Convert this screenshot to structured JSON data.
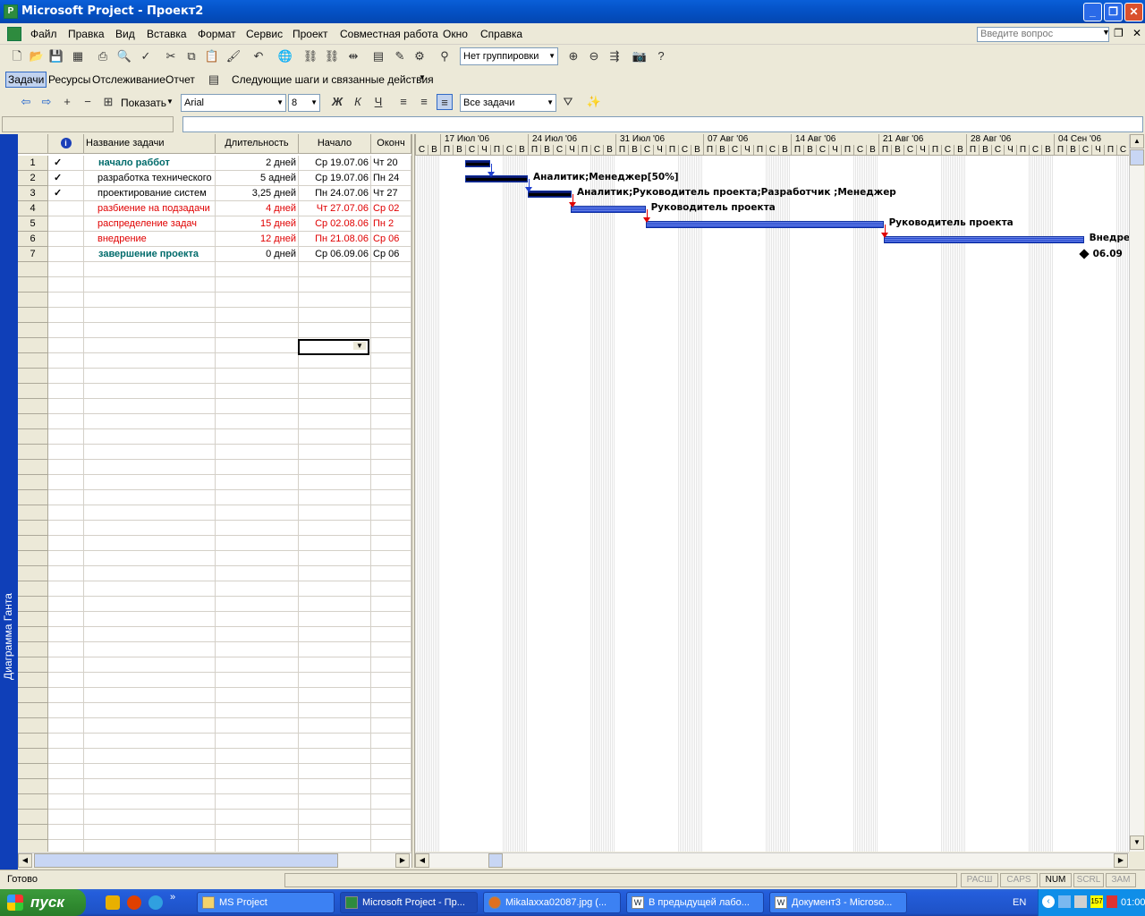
{
  "window": {
    "title": "Microsoft Project - Проект2"
  },
  "menu": [
    "Файл",
    "Правка",
    "Вид",
    "Вставка",
    "Формат",
    "Сервис",
    "Проект",
    "Совместная работа",
    "Окно",
    "Справка"
  ],
  "ask_placeholder": "Введите вопрос",
  "toolbar": {
    "grouping": "Нет группировки",
    "guide_tabs": [
      "Задачи",
      "Ресурсы",
      "Отслеживание",
      "Отчет"
    ],
    "next_steps": "Следующие шаги и связанные действия",
    "show_label": "Показать",
    "font": "Arial",
    "font_size": "8",
    "bold": "Ж",
    "italic": "К",
    "underline": "Ч",
    "filter": "Все задачи"
  },
  "viewbar_label": "Диаграмма Ганта",
  "table": {
    "headers": [
      "Название задачи",
      "Длительность",
      "Начало",
      "Оконч"
    ],
    "rows": [
      {
        "id": "1",
        "name": "начало раббот",
        "duration": "2 дней",
        "start": "Ср 19.07.06",
        "finish": "Чт 20",
        "done": true,
        "style": "summary"
      },
      {
        "id": "2",
        "name": "разработка технического",
        "duration": "5 адней",
        "start": "Ср 19.07.06",
        "finish": "Пн 24",
        "done": true,
        "style": "normal"
      },
      {
        "id": "3",
        "name": "проектирование систем",
        "duration": "3,25 дней",
        "start": "Пн 24.07.06",
        "finish": "Чт 27",
        "done": true,
        "style": "normal"
      },
      {
        "id": "4",
        "name": "разбиение на подзадачи",
        "duration": "4 дней",
        "start": "Чт 27.07.06",
        "finish": "Ср 02",
        "done": false,
        "style": "critical"
      },
      {
        "id": "5",
        "name": "распределение задач",
        "duration": "15 дней",
        "start": "Ср 02.08.06",
        "finish": "Пн 2",
        "done": false,
        "style": "critical"
      },
      {
        "id": "6",
        "name": "внедрение",
        "duration": "12 дней",
        "start": "Пн 21.08.06",
        "finish": "Ср 06",
        "done": false,
        "style": "critical"
      },
      {
        "id": "7",
        "name": "завершение проекта",
        "duration": "0 дней",
        "start": "Ср 06.09.06",
        "finish": "Ср 06",
        "done": false,
        "style": "summary"
      }
    ]
  },
  "gantt": {
    "weeks": [
      "17 Июл '06",
      "24 Июл '06",
      "31 Июл '06",
      "07 Авг '06",
      "14 Авг '06",
      "21 Авг '06",
      "28 Авг '06",
      "04 Сен '06"
    ],
    "day_letters": [
      "С",
      "В",
      "П",
      "В",
      "С",
      "Ч",
      "П"
    ],
    "labels": [
      "Аналитик;Менеджер[50%]",
      "Аналитик;Руководитель проекта;Разработчик ;Менеджер",
      "Руководитель проекта",
      "Руководитель проекта",
      "Внедре",
      "06.09"
    ]
  },
  "status": {
    "text": "Готово",
    "indicators": [
      {
        "label": "РАСШ",
        "on": false
      },
      {
        "label": "CAPS",
        "on": false
      },
      {
        "label": "NUM",
        "on": true
      },
      {
        "label": "SCRL",
        "on": false
      },
      {
        "label": "ЗАМ",
        "on": false
      }
    ]
  },
  "taskbar": {
    "start": "пуск",
    "buttons": [
      "MS Project",
      "Microsoft Project - Пр...",
      "Mikalaxxa02087.jpg (...",
      "В предыдущей лабо...",
      "Документ3 - Microso..."
    ],
    "lang": "EN",
    "time": "01:00"
  }
}
